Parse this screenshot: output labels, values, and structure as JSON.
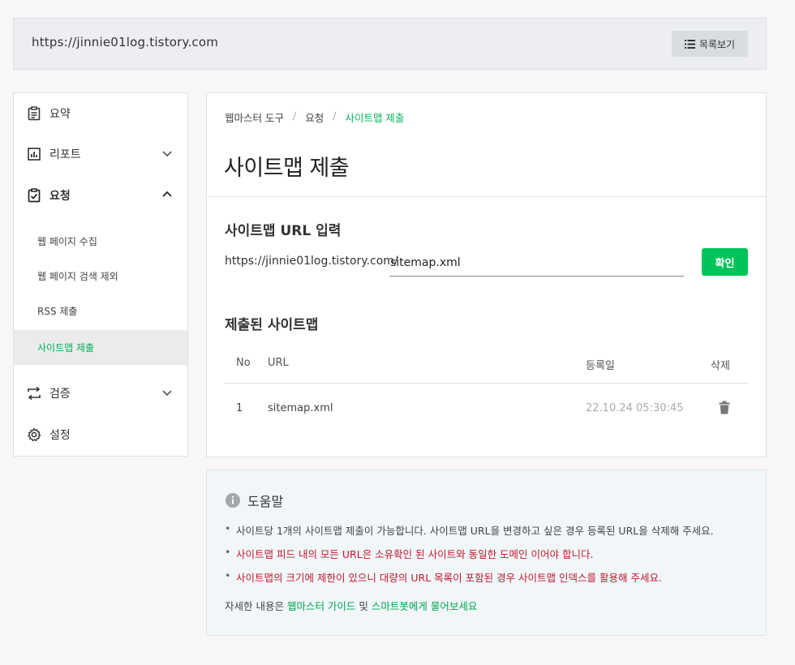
{
  "site": {
    "url": "https://jinnie01log.tistory.com",
    "list_button": "목록보기"
  },
  "sidebar": {
    "items": [
      {
        "label": "요약",
        "icon": "clipboard-icon"
      },
      {
        "label": "리포트",
        "icon": "bar-chart-icon"
      },
      {
        "label": "요청",
        "icon": "clipboard-check-icon"
      },
      {
        "label": "검증",
        "icon": "repeat-icon"
      },
      {
        "label": "설정",
        "icon": "gear-icon"
      }
    ],
    "sub_items": [
      "웹 페이지 수집",
      "웹 페이지 검색 제외",
      "RSS 제출",
      "사이트맵 제출"
    ]
  },
  "breadcrumb": [
    "웹마스터 도구",
    "요청",
    "사이트맵 제출"
  ],
  "page_title": "사이트맵 제출",
  "url_section": {
    "heading": "사이트맵 URL 입력",
    "prefix": "https://jinnie01log.tistory.com/",
    "input_value": "sitemap.xml",
    "confirm_label": "확인"
  },
  "submitted": {
    "heading": "제출된 사이트맵",
    "columns": [
      "No",
      "URL",
      "등록일",
      "삭제"
    ],
    "rows": [
      {
        "no": "1",
        "url": "sitemap.xml",
        "date": "22.10.24 05:30:45"
      }
    ]
  },
  "help": {
    "title": "도움말",
    "items": [
      "사이트당 1개의 사이트맵 제출이 가능합니다. 사이트맵 URL을 변경하고 싶은 경우 등록된 URL을 삭제해 주세요.",
      "사이트맵 피드 내의 모든 URL은 소유확인 된 사이트와 동일한 도메인 이어야 합니다.",
      "사이트맵의 크기에 제한이 있으니 대량의 URL 목록이 포함된 경우 사이트맵 인덱스를 활용해 주세요."
    ],
    "footer_prefix": "자세한 내용은 ",
    "footer_link1": "웹마스터 가이드",
    "footer_mid": " 및 ",
    "footer_link2": "스마트봇에게 물어보세요"
  },
  "colors": {
    "accent": "#00c45a",
    "warning_text": "#c0182b",
    "link": "#00a650"
  }
}
